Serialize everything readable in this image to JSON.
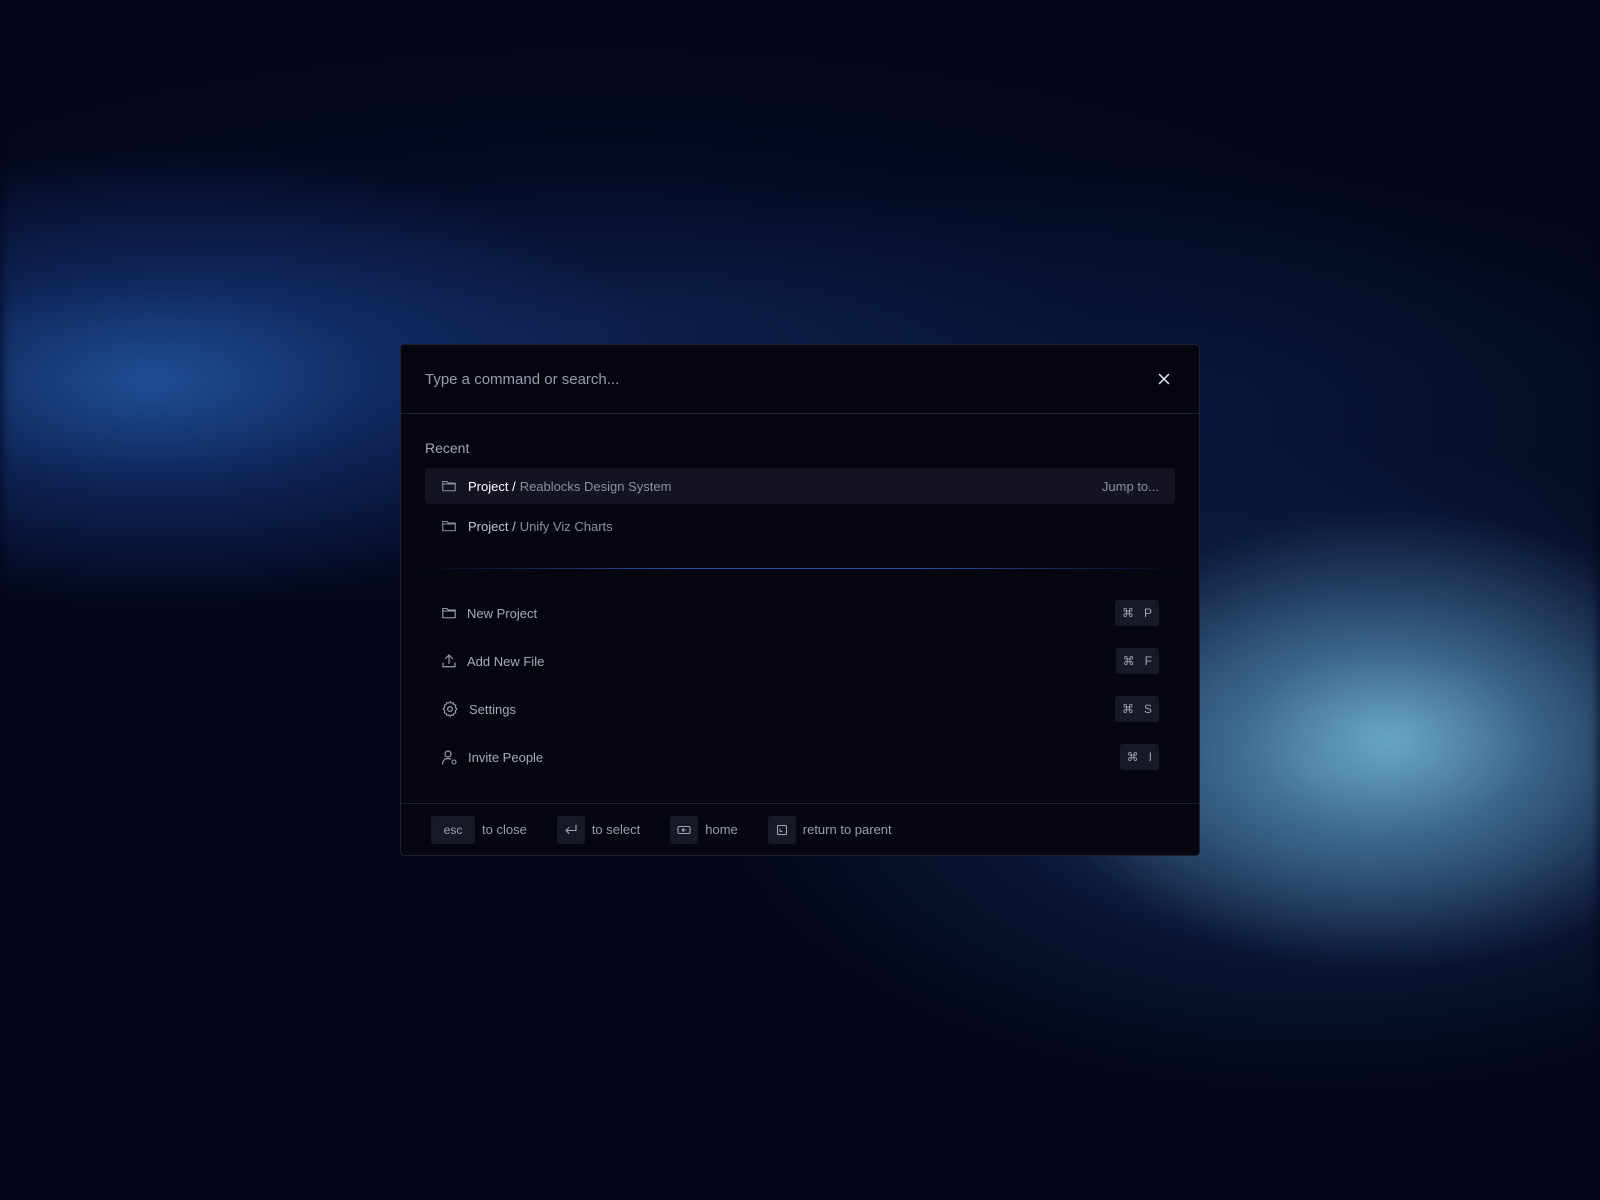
{
  "search": {
    "placeholder": "Type a command or search..."
  },
  "recent": {
    "title": "Recent",
    "items": [
      {
        "prefix": "Project /",
        "name": "Reablocks Design System",
        "hint": "Jump to...",
        "icon": "folder-icon",
        "active": true
      },
      {
        "prefix": "Project /",
        "name": "Unify Viz Charts",
        "icon": "folder-icon",
        "active": false
      }
    ]
  },
  "actions": [
    {
      "label": "New Project",
      "icon": "folder-icon",
      "shortcut": {
        "modifier": "⌘",
        "key": "P"
      }
    },
    {
      "label": "Add New File",
      "icon": "upload-icon",
      "shortcut": {
        "modifier": "⌘",
        "key": "F"
      }
    },
    {
      "label": "Settings",
      "icon": "gear-icon",
      "shortcut": {
        "modifier": "⌘",
        "key": "S"
      }
    },
    {
      "label": "Invite People",
      "icon": "user-settings-icon",
      "shortcut": {
        "modifier": "⌘",
        "key": "I"
      }
    }
  ],
  "footer": {
    "close": {
      "key": "esc",
      "label": "to close"
    },
    "select": {
      "icon": "enter-icon",
      "label": "to select"
    },
    "home": {
      "icon": "backspace-icon",
      "label": "home"
    },
    "parent": {
      "icon": "return-parent-icon",
      "label": "return to parent"
    }
  },
  "colors": {
    "panel_bg": "#05060f",
    "active_row_bg": "#13141f",
    "kbd_bg": "#171925",
    "divider_accent": "#285abe"
  }
}
